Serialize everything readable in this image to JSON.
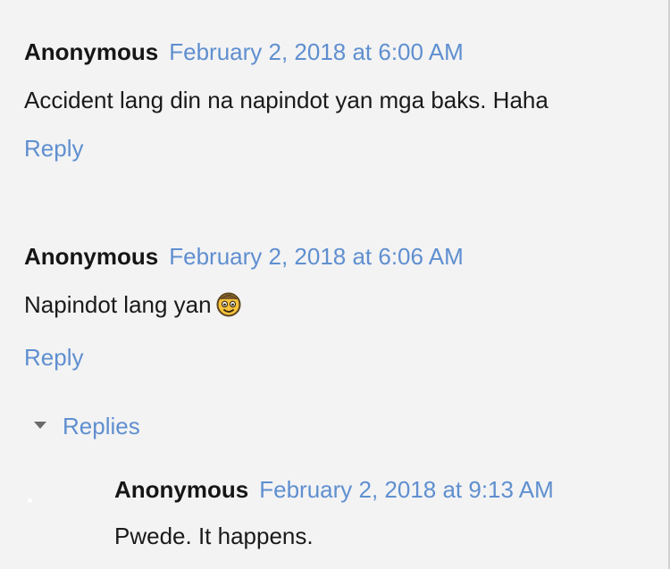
{
  "comments": [
    {
      "author": "Anonymous",
      "date": "February 2, 2018 at 6:00 AM",
      "text": "Accident lang din na napindot yan mga baks. Haha",
      "reply_label": "Reply"
    },
    {
      "author": "Anonymous",
      "date": "February 2, 2018 at 6:06 AM",
      "text": "Napindot lang yan",
      "emoji": "smiling-face-emoji",
      "reply_label": "Reply"
    }
  ],
  "replies": {
    "toggle_label": "Replies",
    "items": [
      {
        "author": "Anonymous",
        "date": "February 2, 2018 at 9:13 AM",
        "text": "Pwede. It happens."
      }
    ]
  },
  "colors": {
    "background": "#f3f3f4",
    "link": "#5f8fcf",
    "text": "#111111"
  }
}
